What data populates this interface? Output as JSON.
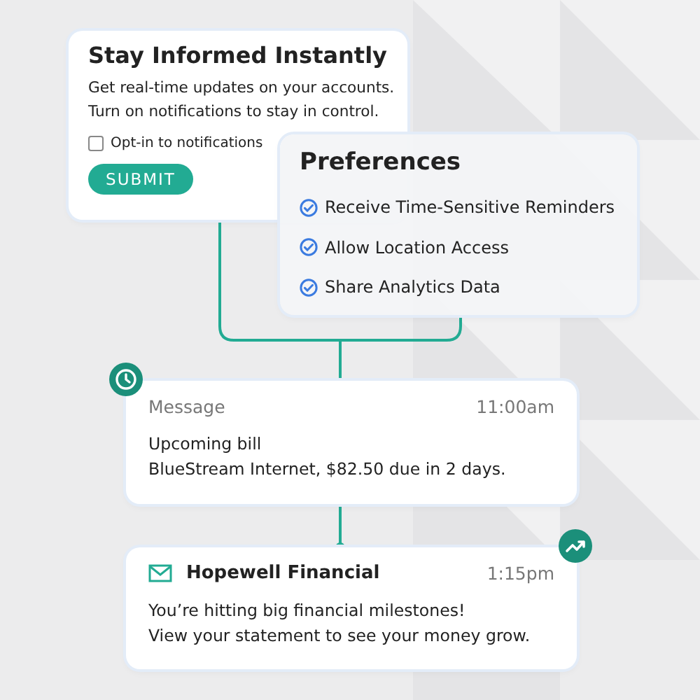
{
  "signup_card": {
    "title": "Stay Informed Instantly",
    "description_lines": [
      "Get real-time updates on your accounts.",
      "Turn on notifications to stay in control."
    ],
    "checkbox": {
      "label": "Opt-in to notifications",
      "checked": false
    },
    "button": "SUBMIT"
  },
  "preferences_card": {
    "title": "Preferences",
    "items": [
      {
        "label": "Receive Time-Sensitive Reminders",
        "checked": true
      },
      {
        "label": "Allow Location Access",
        "checked": true
      },
      {
        "label": "Share Analytics Data",
        "checked": true
      }
    ]
  },
  "notifications": [
    {
      "kind": "message",
      "sender": "Message",
      "time": "11:00am",
      "lines": [
        "Upcoming bill",
        "BlueStream Internet, $82.50 due in 2 days."
      ]
    },
    {
      "kind": "email",
      "sender": "Hopewell Financial",
      "time": "1:15pm",
      "lines": [
        "You’re hitting big financial milestones!",
        "View your statement to see your money grow."
      ]
    }
  ]
}
